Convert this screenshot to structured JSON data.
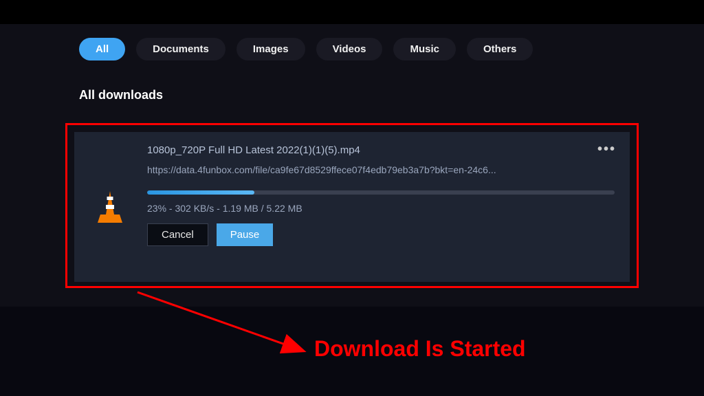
{
  "tabs": {
    "all": "All",
    "documents": "Documents",
    "images": "Images",
    "videos": "Videos",
    "music": "Music",
    "others": "Others"
  },
  "heading": "All downloads",
  "download": {
    "filename": "1080p_720P Full HD Latest 2022(1)(1)(5).mp4",
    "url": "https://data.4funbox.com/file/ca9fe67d8529ffece07f4edb79eb3a7b?bkt=en-24c6...",
    "progress_percent": 23,
    "status_text": "23% - 302 KB/s - 1.19 MB / 5.22 MB",
    "cancel_label": "Cancel",
    "pause_label": "Pause"
  },
  "annotation_text": "Download Is Started"
}
